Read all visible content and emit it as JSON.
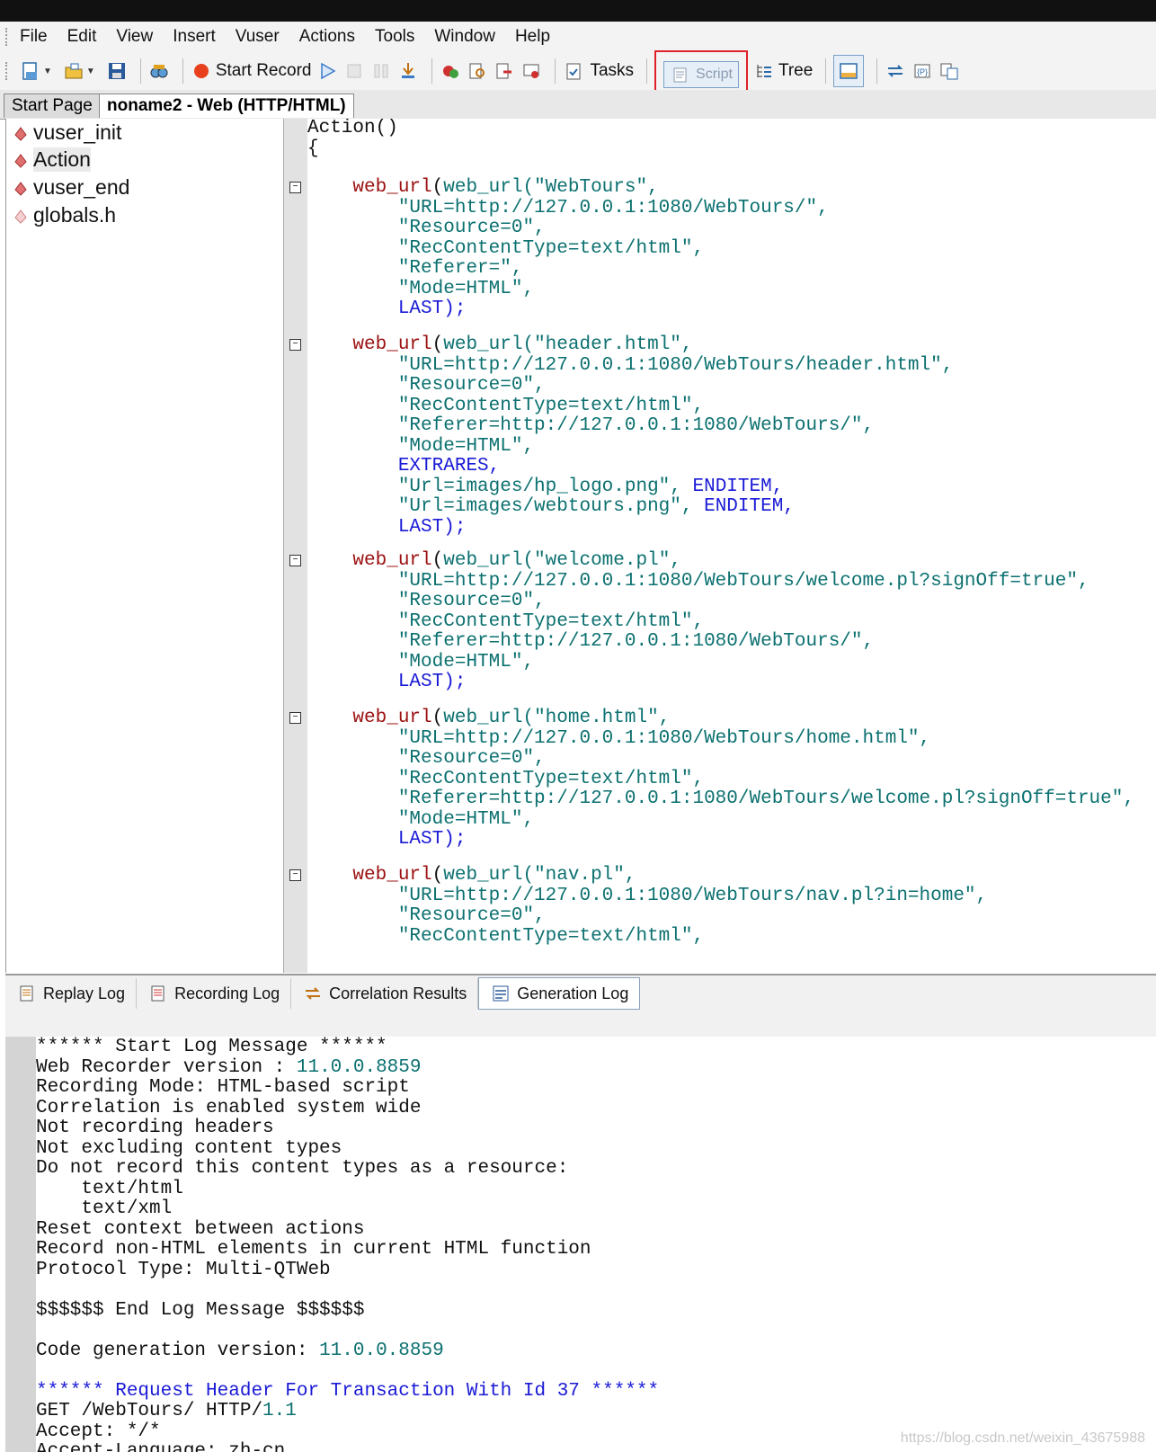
{
  "menu": {
    "items": [
      {
        "label": "File"
      },
      {
        "label": "Edit"
      },
      {
        "label": "View"
      },
      {
        "label": "Insert"
      },
      {
        "label": "Vuser"
      },
      {
        "label": "Actions"
      },
      {
        "label": "Tools"
      },
      {
        "label": "Window"
      },
      {
        "label": "Help"
      }
    ]
  },
  "toolbar": {
    "start_record": "Start Record",
    "tasks": "Tasks",
    "script": "Script",
    "tree": "Tree"
  },
  "doc_tabs": {
    "start_page": "Start Page",
    "current": "noname2 - Web (HTTP/HTML)"
  },
  "tree": {
    "items": [
      "vuser_init",
      "Action",
      "vuser_end",
      "globals.h"
    ]
  },
  "code": {
    "header_1": "Action()",
    "header_2": "{",
    "blocks": [
      {
        "call_1": "web_url(\"WebTours\",",
        "args": [
          "\"URL=http://127.0.0.1:1080/WebTours/\",",
          "\"Resource=0\",",
          "\"RecContentType=text/html\",",
          "\"Referer=\",",
          "\"Mode=HTML\","
        ],
        "end": "LAST);"
      },
      {
        "call_1": "web_url(\"header.html\",",
        "args": [
          "\"URL=http://127.0.0.1:1080/WebTours/header.html\",",
          "\"Resource=0\",",
          "\"RecContentType=text/html\",",
          "\"Referer=http://127.0.0.1:1080/WebTours/\",",
          "\"Mode=HTML\","
        ],
        "extrares": "EXTRARES,",
        "items": [
          {
            "url": "\"Url=images/hp_logo.png\",",
            "end": "ENDITEM,"
          },
          {
            "url": "\"Url=images/webtours.png\",",
            "end": "ENDITEM,"
          }
        ],
        "end": "LAST);"
      },
      {
        "call_1": "web_url(\"welcome.pl\",",
        "args": [
          "\"URL=http://127.0.0.1:1080/WebTours/welcome.pl?signOff=true\",",
          "\"Resource=0\",",
          "\"RecContentType=text/html\",",
          "\"Referer=http://127.0.0.1:1080/WebTours/\",",
          "\"Mode=HTML\","
        ],
        "end": "LAST);"
      },
      {
        "call_1": "web_url(\"home.html\",",
        "args": [
          "\"URL=http://127.0.0.1:1080/WebTours/home.html\",",
          "\"Resource=0\",",
          "\"RecContentType=text/html\",",
          "\"Referer=http://127.0.0.1:1080/WebTours/welcome.pl?signOff=true\",",
          "\"Mode=HTML\","
        ],
        "end": "LAST);"
      },
      {
        "call_1": "web_url(\"nav.pl\",",
        "args": [
          "\"URL=http://127.0.0.1:1080/WebTours/nav.pl?in=home\",",
          "\"Resource=0\",",
          "\"RecContentType=text/html\","
        ]
      }
    ]
  },
  "bottom_tabs": {
    "replay_log": "Replay Log",
    "recording_log": "Recording Log",
    "correlation_results": "Correlation Results",
    "generation_log": "Generation Log"
  },
  "log": {
    "l1": "****** Start Log Message ******",
    "l2a": "Web Recorder version : ",
    "l2b": "11.0.0.8859",
    "l3": "Recording Mode: HTML-based script",
    "l4": "Correlation is enabled system wide",
    "l5": "Not recording headers",
    "l6": "Not excluding content types",
    "l7": "Do not record this content types as a resource:",
    "l8": "text/html",
    "l9": "text/xml",
    "l10": "Reset context between actions",
    "l11": "Record non-HTML elements in current HTML function",
    "l12": "Protocol Type: Multi-QTWeb",
    "l13": "$$$$$$ End Log Message $$$$$$",
    "l14a": "Code generation version: ",
    "l14b": "11.0.0.8859",
    "l15": "****** Request Header For Transaction With Id 37 ******",
    "l16a": "GET /WebTours/ HTTP/",
    "l16b": "1.1",
    "l17": "Accept: */*",
    "l18": "Accept-Language: zh-cn"
  },
  "watermark": "https://blog.csdn.net/weixin_43675988"
}
